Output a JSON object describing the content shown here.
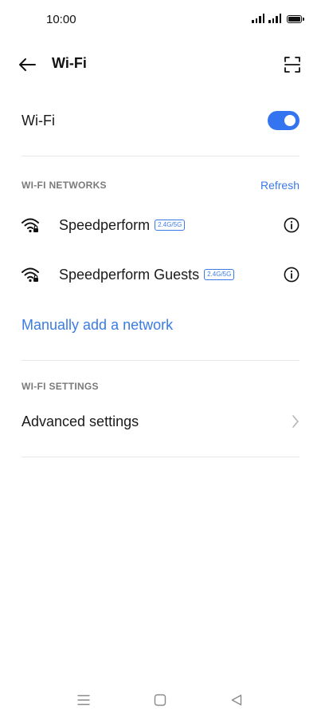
{
  "status_bar": {
    "time": "10:00"
  },
  "app_bar": {
    "title": "Wi-Fi",
    "back_icon": "arrow-left-icon",
    "scan_icon": "qr-scan-icon"
  },
  "wifi_toggle": {
    "label": "Wi-Fi",
    "enabled": true
  },
  "networks_section": {
    "header": "WI-FI NETWORKS",
    "refresh_label": "Refresh",
    "networks": [
      {
        "name": "Speedperform",
        "band": "2.4G/5G",
        "secured": true
      },
      {
        "name": "Speedperform Guests",
        "band": "2.4G/5G",
        "secured": true
      }
    ],
    "manual_add_label": "Manually add a network"
  },
  "settings_section": {
    "header": "WI-FI SETTINGS",
    "advanced_label": "Advanced settings"
  },
  "nav_bar": {
    "menu_icon": "menu-icon",
    "home_icon": "home-square-icon",
    "back_icon": "back-triangle-icon"
  },
  "colors": {
    "accent": "#3b7be6",
    "toggle_on": "#3574f0",
    "section_header": "#7a7a7a",
    "divider": "#e6e6e6"
  }
}
